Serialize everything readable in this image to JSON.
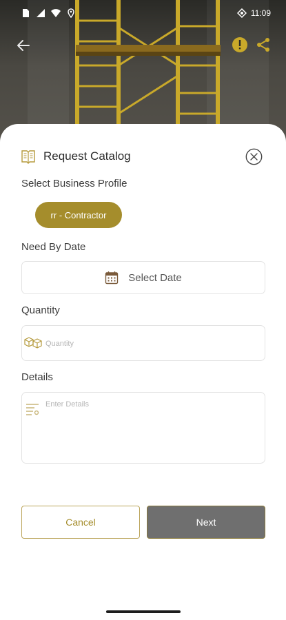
{
  "status_bar": {
    "time": "11:09",
    "icons": [
      "sim-icon",
      "signal-icon",
      "wifi-icon",
      "location-icon",
      "data-saver-icon"
    ]
  },
  "nav": {
    "back_icon": "arrow-left-icon",
    "alert_icon": "alert-icon",
    "share_icon": "share-icon"
  },
  "sheet": {
    "title": "Request Catalog",
    "title_icon": "catalog-book-icon",
    "close_icon": "close-circle-icon",
    "business_profile": {
      "label": "Select Business Profile",
      "selected": "rr - Contractor"
    },
    "need_by_date": {
      "label": "Need By Date",
      "placeholder": "Select Date",
      "icon": "calendar-icon"
    },
    "quantity": {
      "label": "Quantity",
      "placeholder": "Quantity",
      "icon": "boxes-icon"
    },
    "details": {
      "label": "Details",
      "placeholder": "Enter Details",
      "icon": "list-icon"
    },
    "buttons": {
      "cancel": "Cancel",
      "next": "Next"
    }
  },
  "colors": {
    "accent": "#a58d2c",
    "button_disabled": "#6f6f6f",
    "border": "#e3e3e3"
  }
}
